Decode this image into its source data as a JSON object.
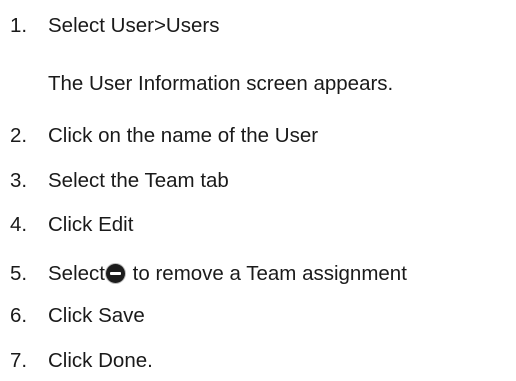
{
  "steps": [
    {
      "num": "1.",
      "text": "Select User>Users"
    },
    {
      "num": "2.",
      "text": "Click on the name of the User"
    },
    {
      "num": "3.",
      "text": "Select the Team tab"
    },
    {
      "num": "4.",
      "text": "Click Edit"
    },
    {
      "num": "5.",
      "text_before": "Select",
      "icon": "remove-circle-icon",
      "text_after": " to remove a Team assignment"
    },
    {
      "num": "6.",
      "text": "Click Save"
    },
    {
      "num": "7.",
      "text": "Click Done."
    }
  ],
  "step1_note": "The User Information screen appears."
}
